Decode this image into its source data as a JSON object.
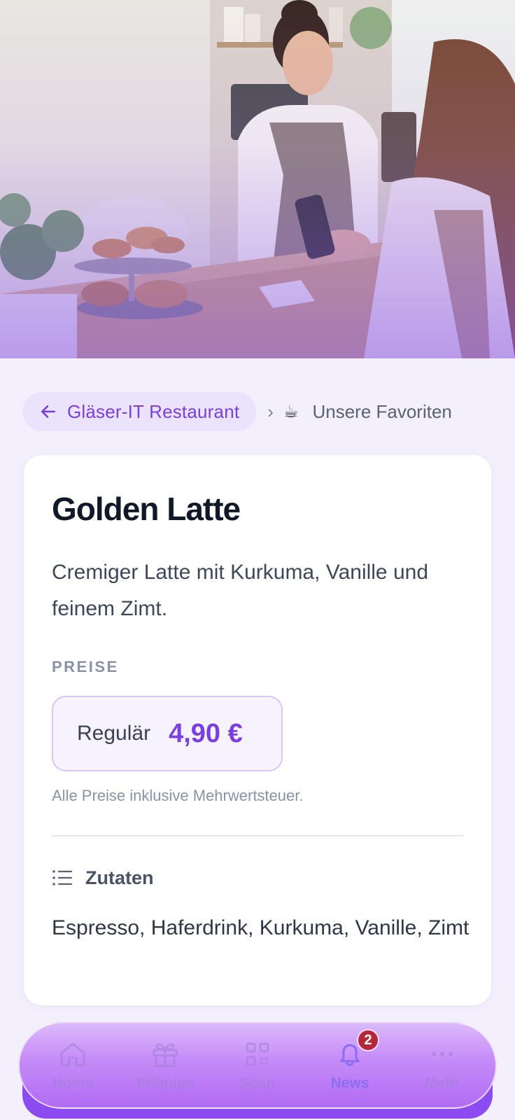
{
  "breadcrumb": {
    "back_label": "Gläser-IT Restaurant",
    "separator": "›",
    "category_icon": "☕",
    "current": "Unsere Favoriten"
  },
  "item": {
    "title": "Golden Latte",
    "description": "Cremiger Latte mit Kurkuma, Vanille und feinem Zimt.",
    "prices_label": "PREISE",
    "prices": [
      {
        "name": "Regulär",
        "value": "4,90 €"
      }
    ],
    "vat_note": "Alle Preise inklusive Mehrwertsteuer.",
    "ingredients_title": "Zutaten",
    "ingredients": "Espresso, Haferdrink, Kurkuma, Vanille, Zimt"
  },
  "nav": {
    "items": [
      {
        "label": "Home",
        "icon": "home-icon"
      },
      {
        "label": "Prämien",
        "icon": "gift-icon"
      },
      {
        "label": "Scan",
        "icon": "qr-scan-icon"
      },
      {
        "label": "News",
        "icon": "bell-icon",
        "badge": "2",
        "active": true
      },
      {
        "label": "Mehr",
        "icon": "more-dots-icon"
      }
    ]
  },
  "colors": {
    "accent": "#7a3fe0",
    "nav_gradient": "#c58af7",
    "badge": "#b5283a"
  }
}
